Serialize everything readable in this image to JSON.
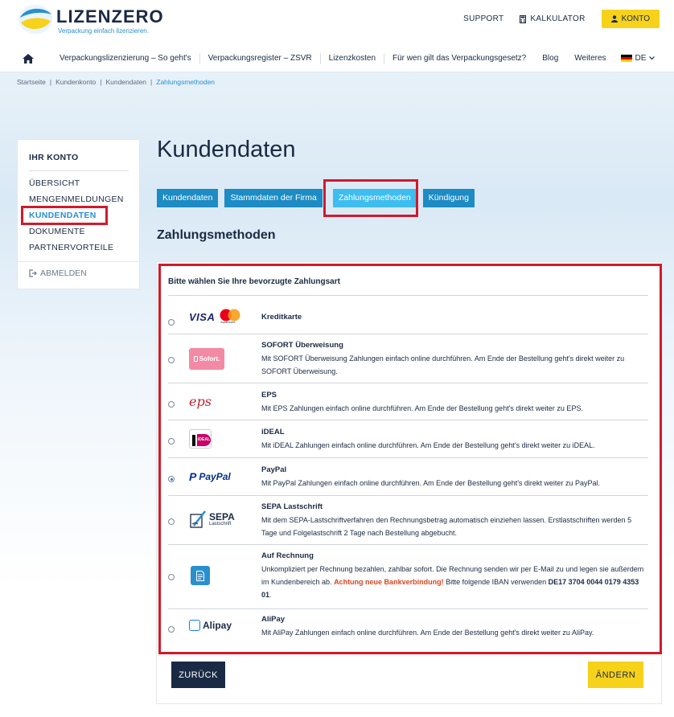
{
  "brand": {
    "name": "LIZENZERO",
    "tagline": "Verpackung einfach lizenzieren."
  },
  "top_links": {
    "support": "SUPPORT",
    "kalkulator": "KALKULATOR",
    "konto": "KONTO"
  },
  "nav": {
    "items": [
      "Verpackungslizenzierung – So geht's",
      "Verpackungsregister – ZSVR",
      "Lizenzkosten",
      "Für wen gilt das Verpackungsgesetz?",
      "Blog",
      "Weiteres"
    ],
    "lang": "DE"
  },
  "breadcrumb": [
    "Startseite",
    "Kundenkonto",
    "Kundendaten",
    "Zahlungsmethoden"
  ],
  "sidebar": {
    "title": "IHR KONTO",
    "items": [
      "ÜBERSICHT",
      "MENGENMELDUNGEN",
      "KUNDENDATEN",
      "DOKUMENTE",
      "PARTNERVORTEILE"
    ],
    "logout": "ABMELDEN"
  },
  "page_title": "Kundendaten",
  "tabs": [
    "Kundendaten",
    "Stammdaten der Firma",
    "Zahlungsmethoden",
    "Kündigung"
  ],
  "section_title": "Zahlungsmethoden",
  "panel_head": "Bitte wählen Sie Ihre bevorzugte Zahlungsart",
  "methods": [
    {
      "name": "Kreditkarte",
      "desc": ""
    },
    {
      "name": "SOFORT Überweisung",
      "desc": "Mit SOFORT Überweisung Zahlungen einfach online durchführen. Am Ende der Bestellung geht's direkt weiter zu SOFORT Überweisung."
    },
    {
      "name": "EPS",
      "desc": "Mit EPS Zahlungen einfach online durchführen. Am Ende der Bestellung geht's direkt weiter zu EPS."
    },
    {
      "name": "iDEAL",
      "desc": "Mit iDEAL Zahlungen einfach online durchführen. Am Ende der Bestellung geht's direkt weiter zu iDEAL."
    },
    {
      "name": "PayPal",
      "desc": "Mit PayPal Zahlungen einfach online durchführen. Am Ende der Bestellung geht's direkt weiter zu PayPal."
    },
    {
      "name": "SEPA Lastschrift",
      "desc": "Mit dem SEPA-Lastschriftverfahren den Rechnungsbetrag automatisch einziehen lassen. Erstlastschriften werden 5 Tage und Folgelastschrift 2 Tage nach Bestellung abgebucht."
    },
    {
      "name": "Auf Rechnung",
      "desc_a": "Unkompliziert per Rechnung bezahlen, zahlbar sofort. Die Rechnung senden wir per E-Mail zu und legen sie außerdem im Kundenbereich ab. ",
      "warning": "Achtung neue Bankverbindung!",
      "desc_b": " Bitte folgende IBAN verwenden ",
      "iban": "DE17 3704 0044 0179 4353 01",
      "desc_c": "."
    },
    {
      "name": "AliPay",
      "desc": "Mit AliPay Zahlungen einfach online durchführen. Am Ende der Bestellung geht's direkt weiter zu AliPay."
    }
  ],
  "selected_method": "PayPal",
  "logos": {
    "visa": "VISA",
    "mastercard": "mastercard",
    "sofort": "Sofort.",
    "eps": "eps",
    "ideal": "iDEAL",
    "paypal": "PayPal",
    "sepa": "SEPA",
    "sepa_sub": "Lastschrift",
    "alipay": "Alipay"
  },
  "buttons": {
    "back": "ZURÜCK",
    "change": "ÄNDERN"
  },
  "colors": {
    "navy": "#1b2a44",
    "accent": "#2a8fd0",
    "tab": "#1d8bc4",
    "tab_active": "#3dbdf0",
    "yellow": "#f6d21b",
    "highlight": "#d11a2a",
    "warning": "#d94622"
  }
}
